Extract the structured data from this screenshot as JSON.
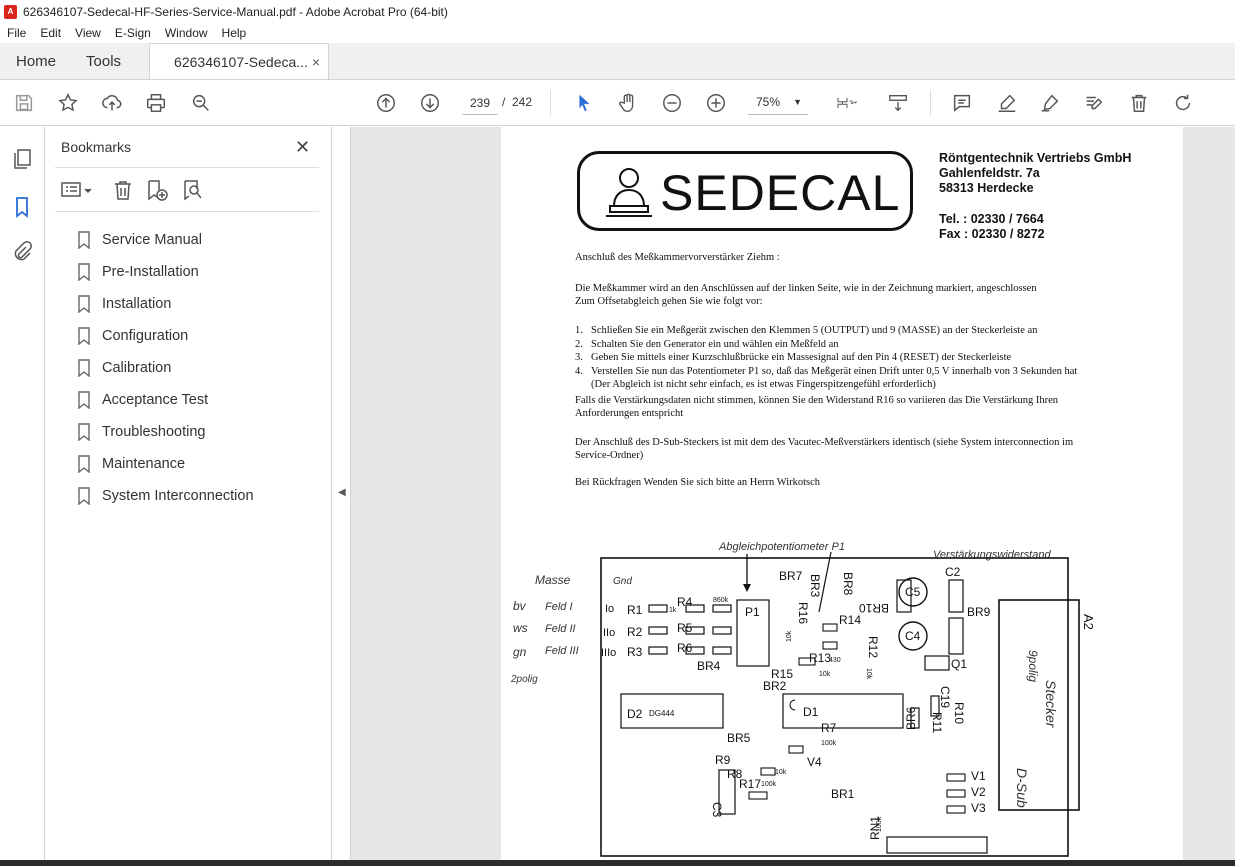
{
  "window": {
    "title": "626346107-Sedecal-HF-Series-Service-Manual.pdf - Adobe Acrobat Pro (64-bit)"
  },
  "menu": [
    "File",
    "Edit",
    "View",
    "E-Sign",
    "Window",
    "Help"
  ],
  "tabs": {
    "home": "Home",
    "tools": "Tools",
    "document": "626346107-Sedeca...",
    "close": "×"
  },
  "toolbar": {
    "current_page": "239",
    "page_separator": "/",
    "total_pages": "242",
    "zoom": "75%"
  },
  "bookmarks": {
    "title": "Bookmarks",
    "items": [
      "Service Manual",
      "Pre-Installation",
      "Installation",
      "Configuration",
      "Calibration",
      "Acceptance Test",
      "Troubleshooting",
      "Maintenance",
      "System Interconnection"
    ]
  },
  "document": {
    "logo": "SEDECAL",
    "company_lines": [
      "Röntgentechnik Vertriebs GmbH",
      "Gahlenfeldstr. 7a",
      "58313 Herdecke"
    ],
    "contact_lines": [
      "Tel. : 02330 / 7664",
      "Fax : 02330 / 8272"
    ],
    "heading": "Anschluß des Meßkammervorverstärker Ziehm :",
    "intro_1": "Die Meßkammer wird an den Anschlüssen auf der linken Seite, wie in der Zeichnung markiert, angeschlossen",
    "intro_2": "Zum Offsetabgleich gehen Sie wie folgt vor:",
    "steps": [
      {
        "num": "1.",
        "text": "Schließen Sie ein Meßgerät zwischen den Klemmen 5 (OUTPUT) und 9 (MASSE) an der Steckerleiste an"
      },
      {
        "num": "2.",
        "text": "Schalten Sie den Generator ein und wählen ein Meßfeld an"
      },
      {
        "num": "3.",
        "text": "Geben Sie mittels einer Kurzschlußbrücke ein Massesignal auf den Pin 4 (RESET) der Steckerleiste"
      },
      {
        "num": "4.",
        "text": "Verstellen Sie nun das Potentiometer P1 so, daß das Meßgerät einen Drift unter 0,5 V innerhalb von 3 Sekunden hat"
      }
    ],
    "step4_note": "(Der Abgleich ist nicht sehr einfach, es ist etwas Fingerspitzengefühl erforderlich)",
    "para_1a": "Falls die Verstärkungsdaten nicht stimmen, können Sie den Widerstand R16 so variieren das Die Verstärkung Ihren",
    "para_1b": "Anforderungen entspricht",
    "para_2a": "Der Anschluß des D-Sub-Steckers ist mit dem des Vacutec-Meßverstärkers identisch (siehe System interconnection im",
    "para_2b": "Service-Ordner)",
    "para_3": "Bei Rückfragen Wenden Sie sich bitte an Herrn Wirkotsch",
    "schematic": {
      "annot_p1": "Abgleichpotentiometer P1",
      "annot_gain": "Verstärkungswiderstand",
      "hand_left": [
        "Masse",
        "Gnd",
        "bv",
        "Feld I",
        "ws",
        "Feld II",
        "gn",
        "Feld III",
        "2polig"
      ],
      "io_labels": [
        "Io",
        "IIo",
        "IIIo"
      ],
      "parts": [
        "R1",
        "R2",
        "R3",
        "R4",
        "R5",
        "R6",
        "P1",
        "BR7",
        "BR3",
        "BR8",
        "R16",
        "R14",
        "BR10",
        "R12",
        "C5",
        "C4",
        "C2",
        "BR9",
        "A2",
        "Q1",
        "BR4",
        "R15",
        "R13",
        "BR2",
        "D2",
        "DG444",
        "D1",
        "R7",
        "BR5",
        "R9",
        "R8",
        "R17",
        "V4",
        "C3",
        "BR1",
        "RN1",
        "BR6",
        "C19",
        "R10",
        "R11",
        "V1",
        "V2",
        "V3"
      ],
      "values": {
        "r1": "1k",
        "r4": "860k",
        "r16": "10k",
        "r13": "430",
        "r15": "10k",
        "r7": "100k",
        "r9": "10k",
        "r8": "100k",
        "r12": "10k",
        "rn1": "100k"
      },
      "dsub": [
        "9polig",
        "Stecker",
        "D-Sub"
      ]
    }
  }
}
